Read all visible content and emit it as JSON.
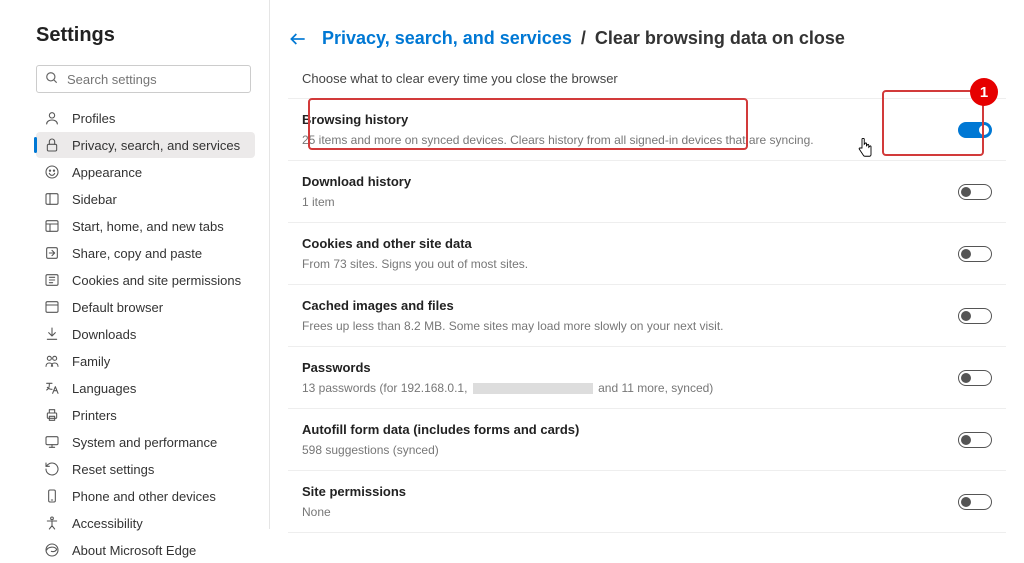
{
  "sidebar": {
    "title": "Settings",
    "search_placeholder": "Search settings",
    "items": [
      {
        "label": "Profiles",
        "icon": "profile"
      },
      {
        "label": "Privacy, search, and services",
        "icon": "lock"
      },
      {
        "label": "Appearance",
        "icon": "appearance"
      },
      {
        "label": "Sidebar",
        "icon": "sidebar"
      },
      {
        "label": "Start, home, and new tabs",
        "icon": "home"
      },
      {
        "label": "Share, copy and paste",
        "icon": "share"
      },
      {
        "label": "Cookies and site permissions",
        "icon": "cookies"
      },
      {
        "label": "Default browser",
        "icon": "browser"
      },
      {
        "label": "Downloads",
        "icon": "download"
      },
      {
        "label": "Family",
        "icon": "family"
      },
      {
        "label": "Languages",
        "icon": "languages"
      },
      {
        "label": "Printers",
        "icon": "printer"
      },
      {
        "label": "System and performance",
        "icon": "system"
      },
      {
        "label": "Reset settings",
        "icon": "reset"
      },
      {
        "label": "Phone and other devices",
        "icon": "phone"
      },
      {
        "label": "Accessibility",
        "icon": "accessibility"
      },
      {
        "label": "About Microsoft Edge",
        "icon": "edge"
      }
    ],
    "active_index": 1
  },
  "breadcrumb": {
    "parent": "Privacy, search, and services",
    "current": "Clear browsing data on close"
  },
  "subtitle": "Choose what to clear every time you close the browser",
  "rows": [
    {
      "title": "Browsing history",
      "desc": "25 items and more on synced devices. Clears history from all signed-in devices that are syncing.",
      "on": true
    },
    {
      "title": "Download history",
      "desc": "1 item",
      "on": false
    },
    {
      "title": "Cookies and other site data",
      "desc": "From 73 sites. Signs you out of most sites.",
      "on": false
    },
    {
      "title": "Cached images and files",
      "desc": "Frees up less than 8.2 MB. Some sites may load more slowly on your next visit.",
      "on": false
    },
    {
      "title": "Passwords",
      "desc_prefix": "13 passwords (for 192.168.0.1, ",
      "desc_suffix": " and 11 more, synced)",
      "on": false,
      "redacted": true
    },
    {
      "title": "Autofill form data (includes forms and cards)",
      "desc": "598 suggestions (synced)",
      "on": false
    },
    {
      "title": "Site permissions",
      "desc": "None",
      "on": false
    }
  ],
  "annotation": {
    "badge": "1"
  }
}
